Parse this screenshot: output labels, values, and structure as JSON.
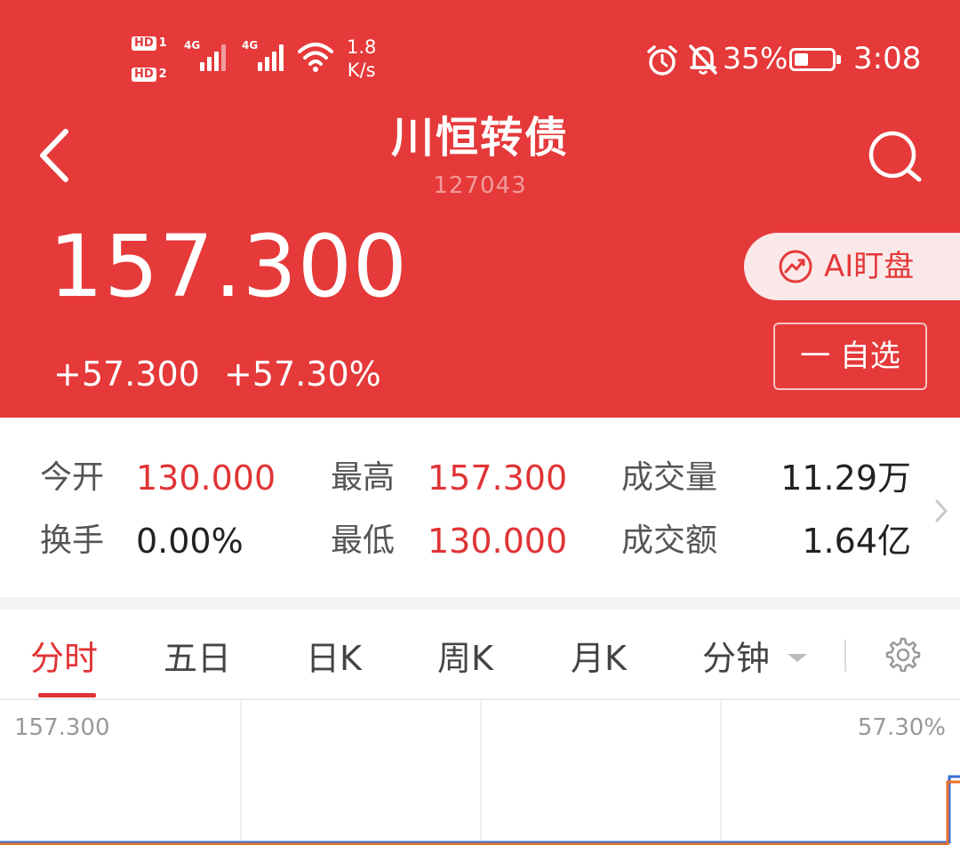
{
  "status_bar": {
    "hd1": "HD",
    "hd1_sub": "1",
    "hd2": "HD",
    "hd2_sub": "2",
    "sim1": "4G",
    "sim2": "4G",
    "speed_value": "1.8",
    "speed_unit": "K/s",
    "battery_pct": "35%",
    "battery_level": 0.35,
    "time": "3:08"
  },
  "header": {
    "title": "川恒转债",
    "code": "127043",
    "price": "157.300",
    "change": "+57.300",
    "change_pct": "+57.30%",
    "ai_label": "AI盯盘",
    "watch_label": "一 自选"
  },
  "stats": {
    "open_label": "今开",
    "open_value": "130.000",
    "high_label": "最高",
    "high_value": "157.300",
    "volume_label": "成交量",
    "volume_value": "11.29万",
    "turnover_label": "换手",
    "turnover_value": "0.00%",
    "low_label": "最低",
    "low_value": "130.000",
    "amount_label": "成交额",
    "amount_value": "1.64亿"
  },
  "tabs": [
    "分时",
    "五日",
    "日K",
    "周K",
    "月K",
    "分钟"
  ],
  "active_tab": "分时",
  "chart": {
    "left_top_label": "157.300",
    "right_top_label": "57.30%"
  },
  "colors": {
    "header_bg": "#e5393a",
    "up_red": "#e03436",
    "line_orange": "#e8702a",
    "line_blue": "#3a6fd8"
  }
}
